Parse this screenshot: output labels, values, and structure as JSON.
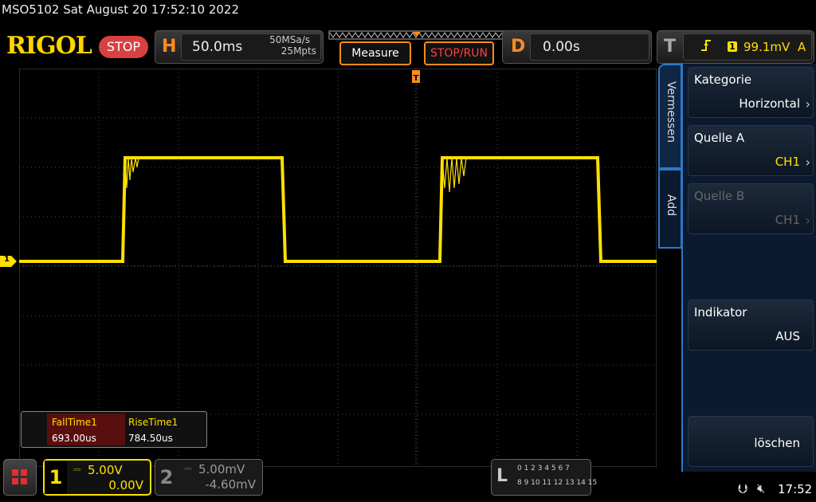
{
  "title": "MSO5102  Sat August 20 17:52:10 2022",
  "brand": "RIGOL",
  "run_state": "STOP",
  "horizontal": {
    "letter": "H",
    "timebase": "50.0ms",
    "sample_rate": "50MSa/s",
    "memory_depth": "25Mpts"
  },
  "buttons": {
    "measure": "Measure",
    "stop_run": "STOP/RUN"
  },
  "delay": {
    "letter": "D",
    "value": "0.00s"
  },
  "trigger": {
    "letter": "T",
    "source": "1",
    "level": "99.1mV",
    "mode": "A"
  },
  "channel_marker": "1",
  "menu": {
    "tabs": [
      "Vermessen",
      "Add"
    ],
    "items": [
      {
        "label": "Kategorie",
        "value": "Horizontal",
        "disabled": false
      },
      {
        "label": "Quelle A",
        "value": "CH1",
        "disabled": false
      },
      {
        "label": "Quelle B",
        "value": "CH1",
        "disabled": true
      },
      {
        "label": "Indikator",
        "value": "AUS",
        "disabled": false
      },
      {
        "label": "",
        "value": "löschen",
        "disabled": false
      }
    ]
  },
  "measurements": {
    "headers": [
      "FallTime1",
      "RiseTime1"
    ],
    "values": [
      "693.00us",
      "784.50us"
    ]
  },
  "channels": [
    {
      "num": "1",
      "scale": "5.00V",
      "offset": "0.00V",
      "color": "#ffe000"
    },
    {
      "num": "2",
      "scale": "5.00mV",
      "offset": "-4.60mV",
      "color": "#888888"
    }
  ],
  "logic": {
    "letter": "L",
    "row1": "0 1 2 3  4 5 6 7",
    "row2": "8 9 10 11 12 13 14 15"
  },
  "status": {
    "time": "17:52",
    "usb_icon": "usb-icon",
    "mute_icon": "speaker-muted-icon"
  },
  "colors": {
    "ch1": "#ffe000",
    "accent": "#ff8c1a",
    "menu_border": "#2d78c8",
    "stop": "#d94040"
  }
}
